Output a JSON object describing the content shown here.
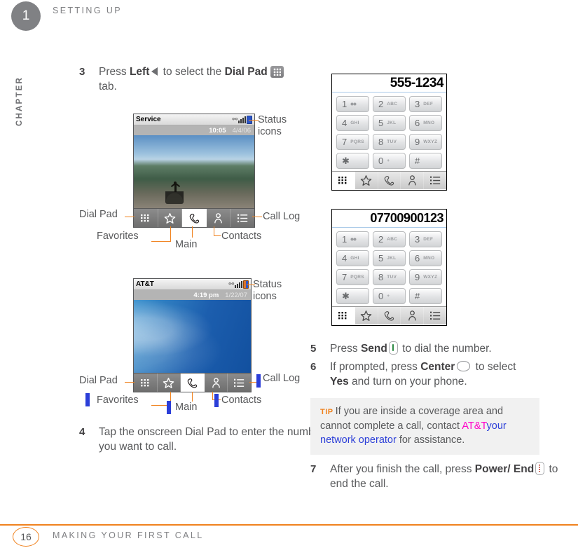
{
  "header": {
    "chapter_number": "1",
    "chapter_word": "CHAPTER",
    "running_head": "SETTING UP"
  },
  "footer": {
    "page_number": "16",
    "title": "MAKING YOUR FIRST CALL"
  },
  "steps": {
    "step3": {
      "num": "3",
      "text_before": "Press ",
      "bold1": "Left",
      "text_mid": " to select the ",
      "bold2": "Dial Pad",
      "text_after": "tab."
    },
    "step4": {
      "num": "4",
      "text": "Tap the onscreen Dial Pad to enter the number you want to call."
    },
    "step5": {
      "num": "5",
      "text_before": "Press ",
      "bold1": "Send",
      "text_after": " to dial the number."
    },
    "step6": {
      "num": "6",
      "text_before": "If prompted, press ",
      "bold1": "Center",
      "text_mid": " to select ",
      "bold2": "Yes",
      "text_after": " and turn on your phone."
    },
    "step7": {
      "num": "7",
      "text_before": "After you finish the call, press ",
      "bold1": "Power/ End",
      "text_after": " to end the call."
    }
  },
  "phone1": {
    "carrier": "Service",
    "time": "10:05",
    "date": "4/4/06",
    "bluetooth_icon": "bluetooth-icon",
    "signal_icon": "signal-bars-icon",
    "battery_icon": "battery-icon",
    "tabs": [
      {
        "name": "dial-pad",
        "label": "Dial Pad"
      },
      {
        "name": "favorites",
        "label": "Favorites"
      },
      {
        "name": "main",
        "label": "Main"
      },
      {
        "name": "contacts",
        "label": "Contacts"
      },
      {
        "name": "call-log",
        "label": "Call Log"
      }
    ]
  },
  "phone2": {
    "carrier": "AT&T",
    "time": "4:19 pm",
    "date": "1/22/07",
    "bluetooth_icon": "bluetooth-icon",
    "signal_icon": "signal-bars-icon",
    "battery_icon": "battery-icon"
  },
  "callouts": {
    "status_icons": "Status\nicons",
    "status_icons_line1": "Status",
    "status_icons_line2": "icons",
    "dial_pad": "Dial Pad",
    "favorites": "Favorites",
    "main": "Main",
    "contacts": "Contacts",
    "call_log": "Call Log"
  },
  "dialpad1": {
    "display": "555-1234",
    "keys": [
      {
        "digit": "1",
        "sub": "",
        "voicemail": true
      },
      {
        "digit": "2",
        "sub": "ABC"
      },
      {
        "digit": "3",
        "sub": "DEF"
      },
      {
        "digit": "4",
        "sub": "GHI"
      },
      {
        "digit": "5",
        "sub": "JKL"
      },
      {
        "digit": "6",
        "sub": "MNO"
      },
      {
        "digit": "7",
        "sub": "PQRS"
      },
      {
        "digit": "8",
        "sub": "TUV"
      },
      {
        "digit": "9",
        "sub": "WXYZ"
      },
      {
        "digit": "✳",
        "sub": ""
      },
      {
        "digit": "0",
        "sub": "+"
      },
      {
        "digit": "#",
        "sub": ""
      }
    ]
  },
  "dialpad2": {
    "display": "07700900123"
  },
  "tip": {
    "label": "TIP",
    "text_before": "If you are inside a coverage area and cannot complete a call, contact ",
    "inserted_magenta": "AT&T",
    "inserted_blue": "your network operator",
    "text_after": " for assistance."
  },
  "colors": {
    "accent_orange": "#f0821e",
    "edit_blue": "#2b3ed8",
    "edit_magenta": "#ff00c8",
    "body_gray": "#58595b"
  }
}
